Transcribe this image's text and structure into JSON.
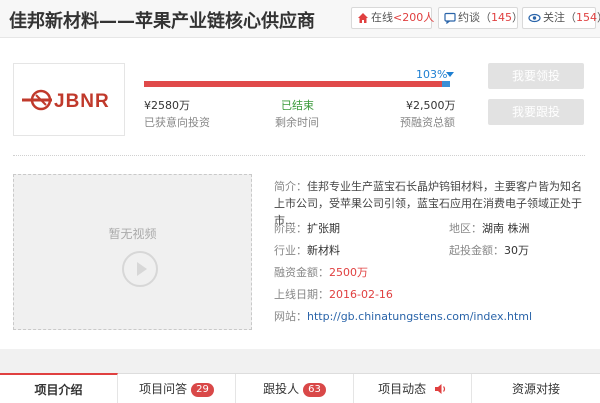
{
  "header": {
    "title": "佳邦新材料——苹果产业链核心供应商",
    "online_label": "在线",
    "online_value": "<200人",
    "talk_label": "约谈",
    "talk_count": "145",
    "follow_label": "关注",
    "follow_count": "154"
  },
  "logo": {
    "text": "JBNR",
    "color": "#c0392b"
  },
  "funding": {
    "percent_text": "103%",
    "progress_ratio": 1.03,
    "invested_value": "¥2580万",
    "invested_label": "已获意向投资",
    "status_value": "已结束",
    "status_label": "剩余时间",
    "target_value": "¥2,500万",
    "target_label": "预融资总额"
  },
  "actions": {
    "invest_label": "我要领投",
    "follow_invest_label": "我要跟投"
  },
  "video": {
    "placeholder": "暂无视频"
  },
  "details": {
    "intro_label": "简介：",
    "intro_text": "佳邦专业生产蓝宝石长晶炉钨钼材料，主要客户皆为知名上市公司，受苹果公司引领，蓝宝石应用在消费电子领域正处于市...",
    "stage_label": "阶段：",
    "stage_value": "扩张期",
    "region_label": "地区：",
    "region_value": "湖南 株洲",
    "industry_label": "行业：",
    "industry_value": "新材料",
    "min_invest_label": "起投金额：",
    "min_invest_value": "30万",
    "amount_label": "融资金额：",
    "amount_value": "2500万",
    "date_label": "上线日期：",
    "date_value": "2016-02-16",
    "site_label": "网站：",
    "site_value": "http://gb.chinatungstens.com/index.html"
  },
  "tabs": [
    {
      "label": "项目介绍"
    },
    {
      "label": "项目问答",
      "badge": "29"
    },
    {
      "label": "跟投人",
      "badge": "63"
    },
    {
      "label": "项目动态"
    },
    {
      "label": "资源对接"
    }
  ],
  "colors": {
    "accent": "#e04040",
    "progress": "#e04a4a",
    "link": "#2a64a9",
    "status_green": "#3a9a3a"
  }
}
